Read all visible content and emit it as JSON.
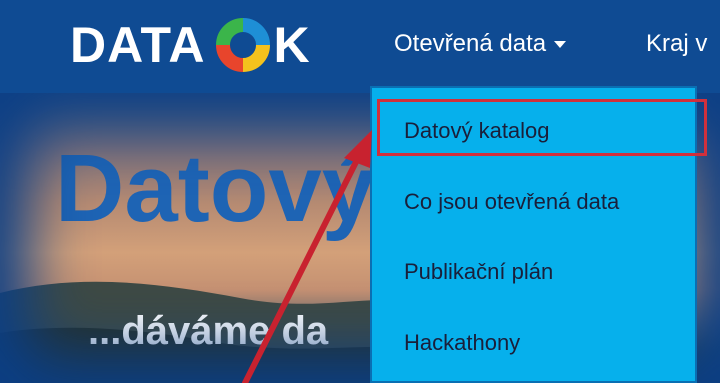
{
  "header": {
    "logo_left": "DATA",
    "logo_right": "K",
    "nav": [
      {
        "label": "Otevřená data"
      },
      {
        "label": "Kraj v"
      }
    ]
  },
  "hero": {
    "title": "Datový",
    "subtitle": "...dáváme da"
  },
  "dropdown": {
    "items": [
      {
        "label": "Datový katalog"
      },
      {
        "label": "Co jsou otevřená data"
      },
      {
        "label": "Publikační plán"
      },
      {
        "label": "Hackathony"
      }
    ]
  },
  "colors": {
    "navbar": "#0f4b93",
    "dropdown": "#06b0ec",
    "highlight": "#d0303c",
    "hero_title": "#1e64b4",
    "logo_ring": [
      "#1e8fd6",
      "#f4c21d",
      "#e8452c",
      "#3bb54a"
    ]
  }
}
